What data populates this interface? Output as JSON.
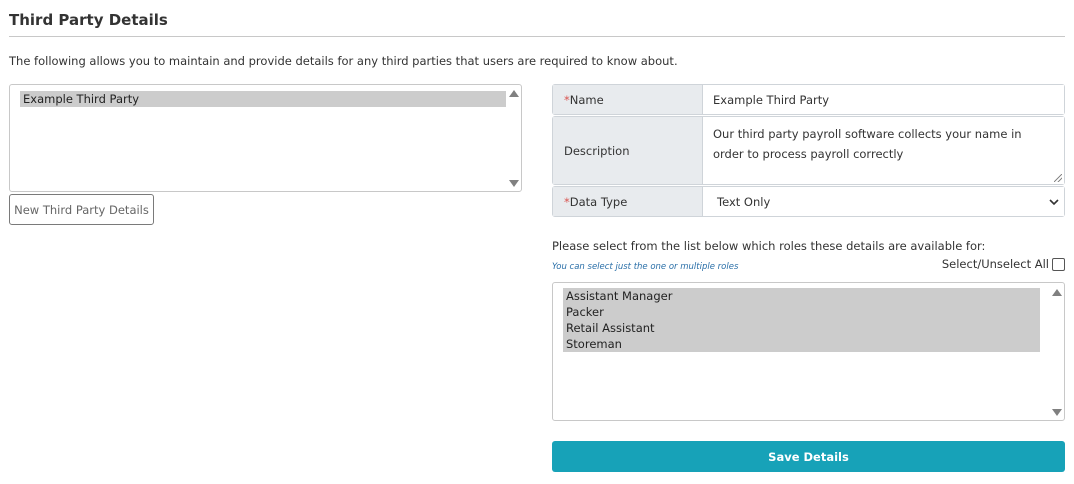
{
  "page": {
    "title": "Third Party Details",
    "intro": "The following allows you to maintain and provide details for any third parties that users are required to know about."
  },
  "third_parties": {
    "items": [
      "Example Third Party"
    ],
    "new_button_label": "New Third Party Details"
  },
  "form": {
    "name_label": "Name",
    "name_value": "Example Third Party",
    "description_label": "Description",
    "description_value": "Our third party payroll software collects your name in order to process payroll correctly",
    "data_type_label": "Data Type",
    "data_type_value": "Text Only",
    "required_marker": "*"
  },
  "roles": {
    "prompt": "Please select from the list below which roles these details are available for:",
    "hint": "You can select just the one or multiple roles",
    "select_all_label": "Select/Unselect All",
    "select_all_checked": false,
    "items": [
      "Assistant Manager",
      "Packer",
      "Retail Assistant",
      "Storeman"
    ]
  },
  "save_button_label": "Save Details",
  "colors": {
    "accent": "#17a2b8",
    "required": "#d9534f",
    "selected_item": "#cccccc",
    "label_bg": "#e8ebee"
  }
}
